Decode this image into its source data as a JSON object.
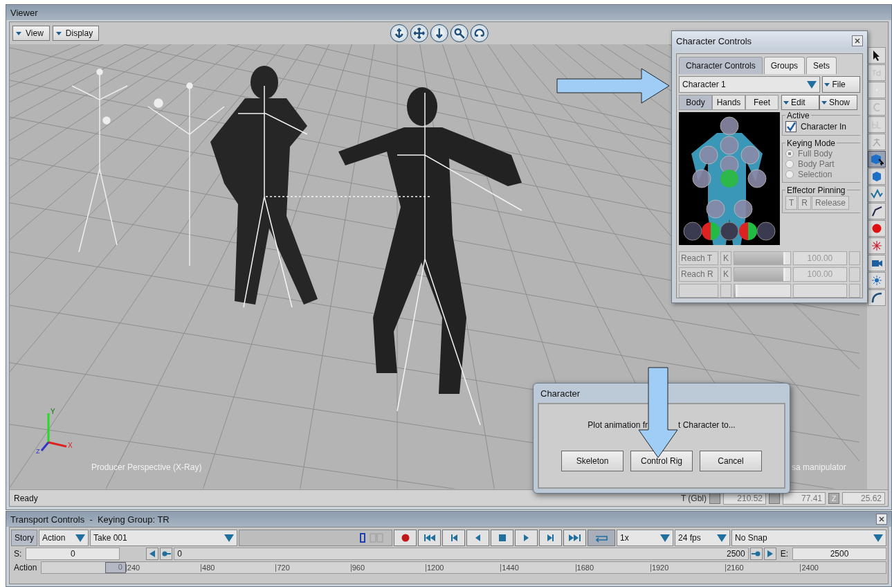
{
  "viewer": {
    "title": "Viewer",
    "menus": [
      {
        "label": "View"
      },
      {
        "label": "Display"
      }
    ],
    "nav_tools": [
      {
        "kind": "anchor"
      },
      {
        "kind": "move"
      },
      {
        "kind": "dolly"
      },
      {
        "kind": "zoom"
      },
      {
        "kind": "orbit"
      }
    ],
    "camera_label": "Producer Perspective (X-Ray)",
    "hint": "sa manipulator",
    "axis_labels": [
      "X",
      "Y",
      "Z"
    ],
    "tools": [
      {
        "kind": "pointer",
        "selected": false
      },
      {
        "kind": "td",
        "selected": false
      },
      {
        "kind": "blank",
        "selected": false
      },
      {
        "kind": "c",
        "selected": false
      },
      {
        "kind": "bl",
        "selected": false
      },
      {
        "kind": "figure",
        "selected": false
      },
      {
        "kind": "cube-pointer",
        "selected": true
      },
      {
        "kind": "cube",
        "selected": false
      },
      {
        "kind": "curve",
        "selected": false
      },
      {
        "kind": "bone",
        "selected": false
      },
      {
        "kind": "dot",
        "selected": false
      },
      {
        "kind": "star",
        "selected": false
      },
      {
        "kind": "camera",
        "selected": false
      },
      {
        "kind": "light",
        "selected": false
      },
      {
        "kind": "arc",
        "selected": false
      }
    ],
    "status": "Ready",
    "coords": {
      "label": "T (Gbl)",
      "fields": [
        {
          "value": "210.52"
        },
        {
          "value": "77.41"
        },
        {
          "axis": "Z",
          "value": "25.62"
        }
      ]
    }
  },
  "character_controls": {
    "title": "Character Controls",
    "tabs": [
      {
        "label": "Character Controls",
        "selected": true
      },
      {
        "label": "Groups",
        "selected": false
      },
      {
        "label": "Sets",
        "selected": false
      }
    ],
    "character": "Character 1",
    "file_menu": "File",
    "body_tabs": [
      {
        "label": "Body",
        "selected": true
      },
      {
        "label": "Hands",
        "selected": false
      },
      {
        "label": "Feet",
        "selected": false
      }
    ],
    "menus": [
      "Edit",
      "Show"
    ],
    "active": {
      "title": "Active",
      "label": "Character In",
      "checked": true
    },
    "keying_mode": {
      "title": "Keying Mode",
      "disabled": true,
      "options": [
        {
          "label": "Full Body",
          "selected": true
        },
        {
          "label": "Body Part",
          "selected": false
        },
        {
          "label": "Selection",
          "selected": false
        }
      ]
    },
    "effector_pinning": {
      "title": "Effector Pinning",
      "disabled": true,
      "buttons": [
        "T",
        "R",
        "Release"
      ]
    },
    "properties": [
      {
        "label": "Reach T",
        "key": "K",
        "level": 0.92,
        "value": "100.00",
        "disabled": true
      },
      {
        "label": "Reach R",
        "key": "K",
        "level": 0.92,
        "value": "100.00",
        "disabled": true
      },
      {
        "level": 0.06
      }
    ]
  },
  "dialog": {
    "title": "Character",
    "message_parts": [
      "Plot animation fr",
      "t Character to..."
    ],
    "buttons": [
      "Skeleton",
      "Control Rig",
      "Cancel"
    ]
  },
  "transport": {
    "title": "Transport Controls  -  Keying Group: TR",
    "mode_tab": {
      "label": "Story",
      "selected": true
    },
    "mode_menu": "Action",
    "take": "Take 001",
    "playback_buttons": [
      {
        "kind": "record"
      },
      {
        "kind": "start"
      },
      {
        "kind": "prev-key"
      },
      {
        "kind": "step-back"
      },
      {
        "kind": "stop"
      },
      {
        "kind": "play"
      },
      {
        "kind": "next-key"
      },
      {
        "kind": "end"
      }
    ],
    "loop": {
      "on": true
    },
    "speed": "1x",
    "fps": "24 fps",
    "snap": "No Snap",
    "start_label": "S:",
    "start": "0",
    "zoom_start": "0",
    "zoom_end": "2500",
    "end_label": "E:",
    "end": "2500",
    "ruler": {
      "label": "Action",
      "thumb": "0",
      "ticks": [
        "240",
        "480",
        "720",
        "960",
        "1200",
        "1440",
        "1680",
        "1920",
        "2160",
        "2400"
      ]
    }
  }
}
